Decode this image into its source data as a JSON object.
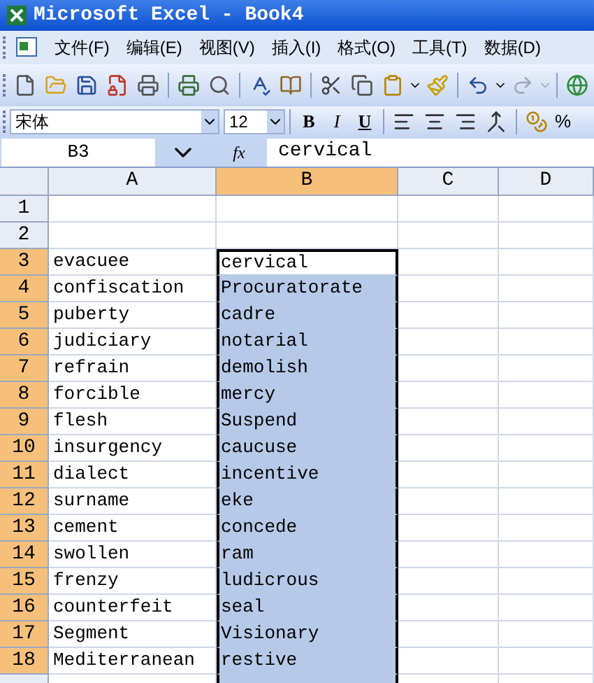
{
  "window": {
    "title": "Microsoft Excel - Book4"
  },
  "menu": [
    "文件(F)",
    "编辑(E)",
    "视图(V)",
    "插入(I)",
    "格式(O)",
    "工具(T)",
    "数据(D)"
  ],
  "format_bar": {
    "font": "宋体",
    "size": "12",
    "bold": "B",
    "italic": "I",
    "underline": "U",
    "percent": "%"
  },
  "formula_bar": {
    "name_box": "B3",
    "fx": "fx",
    "value": "cervical"
  },
  "columns": [
    {
      "label": "A",
      "selected": false
    },
    {
      "label": "B",
      "selected": true
    },
    {
      "label": "C",
      "selected": false
    },
    {
      "label": "D",
      "selected": false
    }
  ],
  "rows": [
    {
      "header": "1",
      "selected": false
    },
    {
      "header": "2",
      "selected": false
    },
    {
      "header": "3",
      "selected": true,
      "cells": [
        {
          "text": "evacuee"
        },
        {
          "text": "cervical",
          "selected": true,
          "active": true
        }
      ]
    },
    {
      "header": "4",
      "selected": true,
      "cells": [
        {
          "text": "confiscation"
        },
        {
          "text": "Procuratorate",
          "selected": true,
          "active": false
        }
      ]
    },
    {
      "header": "5",
      "selected": true,
      "cells": [
        {
          "text": "puberty"
        },
        {
          "text": "cadre",
          "selected": true,
          "active": false
        }
      ]
    },
    {
      "header": "6",
      "selected": true,
      "cells": [
        {
          "text": "judiciary"
        },
        {
          "text": "notarial",
          "selected": true,
          "active": false
        }
      ]
    },
    {
      "header": "7",
      "selected": true,
      "cells": [
        {
          "text": "refrain"
        },
        {
          "text": "demolish",
          "selected": true,
          "active": false
        }
      ]
    },
    {
      "header": "8",
      "selected": true,
      "cells": [
        {
          "text": "forcible"
        },
        {
          "text": "mercy",
          "selected": true,
          "active": false
        }
      ]
    },
    {
      "header": "9",
      "selected": true,
      "cells": [
        {
          "text": "flesh"
        },
        {
          "text": "Suspend",
          "selected": true,
          "active": false
        }
      ]
    },
    {
      "header": "10",
      "selected": true,
      "cells": [
        {
          "text": "insurgency"
        },
        {
          "text": "caucuse",
          "selected": true,
          "active": false
        }
      ]
    },
    {
      "header": "11",
      "selected": true,
      "cells": [
        {
          "text": "dialect"
        },
        {
          "text": "incentive",
          "selected": true,
          "active": false
        }
      ]
    },
    {
      "header": "12",
      "selected": true,
      "cells": [
        {
          "text": "surname"
        },
        {
          "text": "eke",
          "selected": true,
          "active": false
        }
      ]
    },
    {
      "header": "13",
      "selected": true,
      "cells": [
        {
          "text": "cement"
        },
        {
          "text": "concede",
          "selected": true,
          "active": false
        }
      ]
    },
    {
      "header": "14",
      "selected": true,
      "cells": [
        {
          "text": "swollen"
        },
        {
          "text": "ram",
          "selected": true,
          "active": false
        }
      ]
    },
    {
      "header": "15",
      "selected": true,
      "cells": [
        {
          "text": "frenzy"
        },
        {
          "text": "ludicrous",
          "selected": true,
          "active": false
        }
      ]
    },
    {
      "header": "16",
      "selected": true,
      "cells": [
        {
          "text": "counterfeit"
        },
        {
          "text": "seal",
          "selected": true,
          "active": false
        }
      ]
    },
    {
      "header": "17",
      "selected": true,
      "cells": [
        {
          "text": "Segment"
        },
        {
          "text": "Visionary",
          "selected": true,
          "active": false
        }
      ]
    },
    {
      "header": "18",
      "selected": true,
      "cells": [
        {
          "text": "Mediterranean"
        },
        {
          "text": "restive",
          "selected": true,
          "active": false
        }
      ]
    }
  ]
}
